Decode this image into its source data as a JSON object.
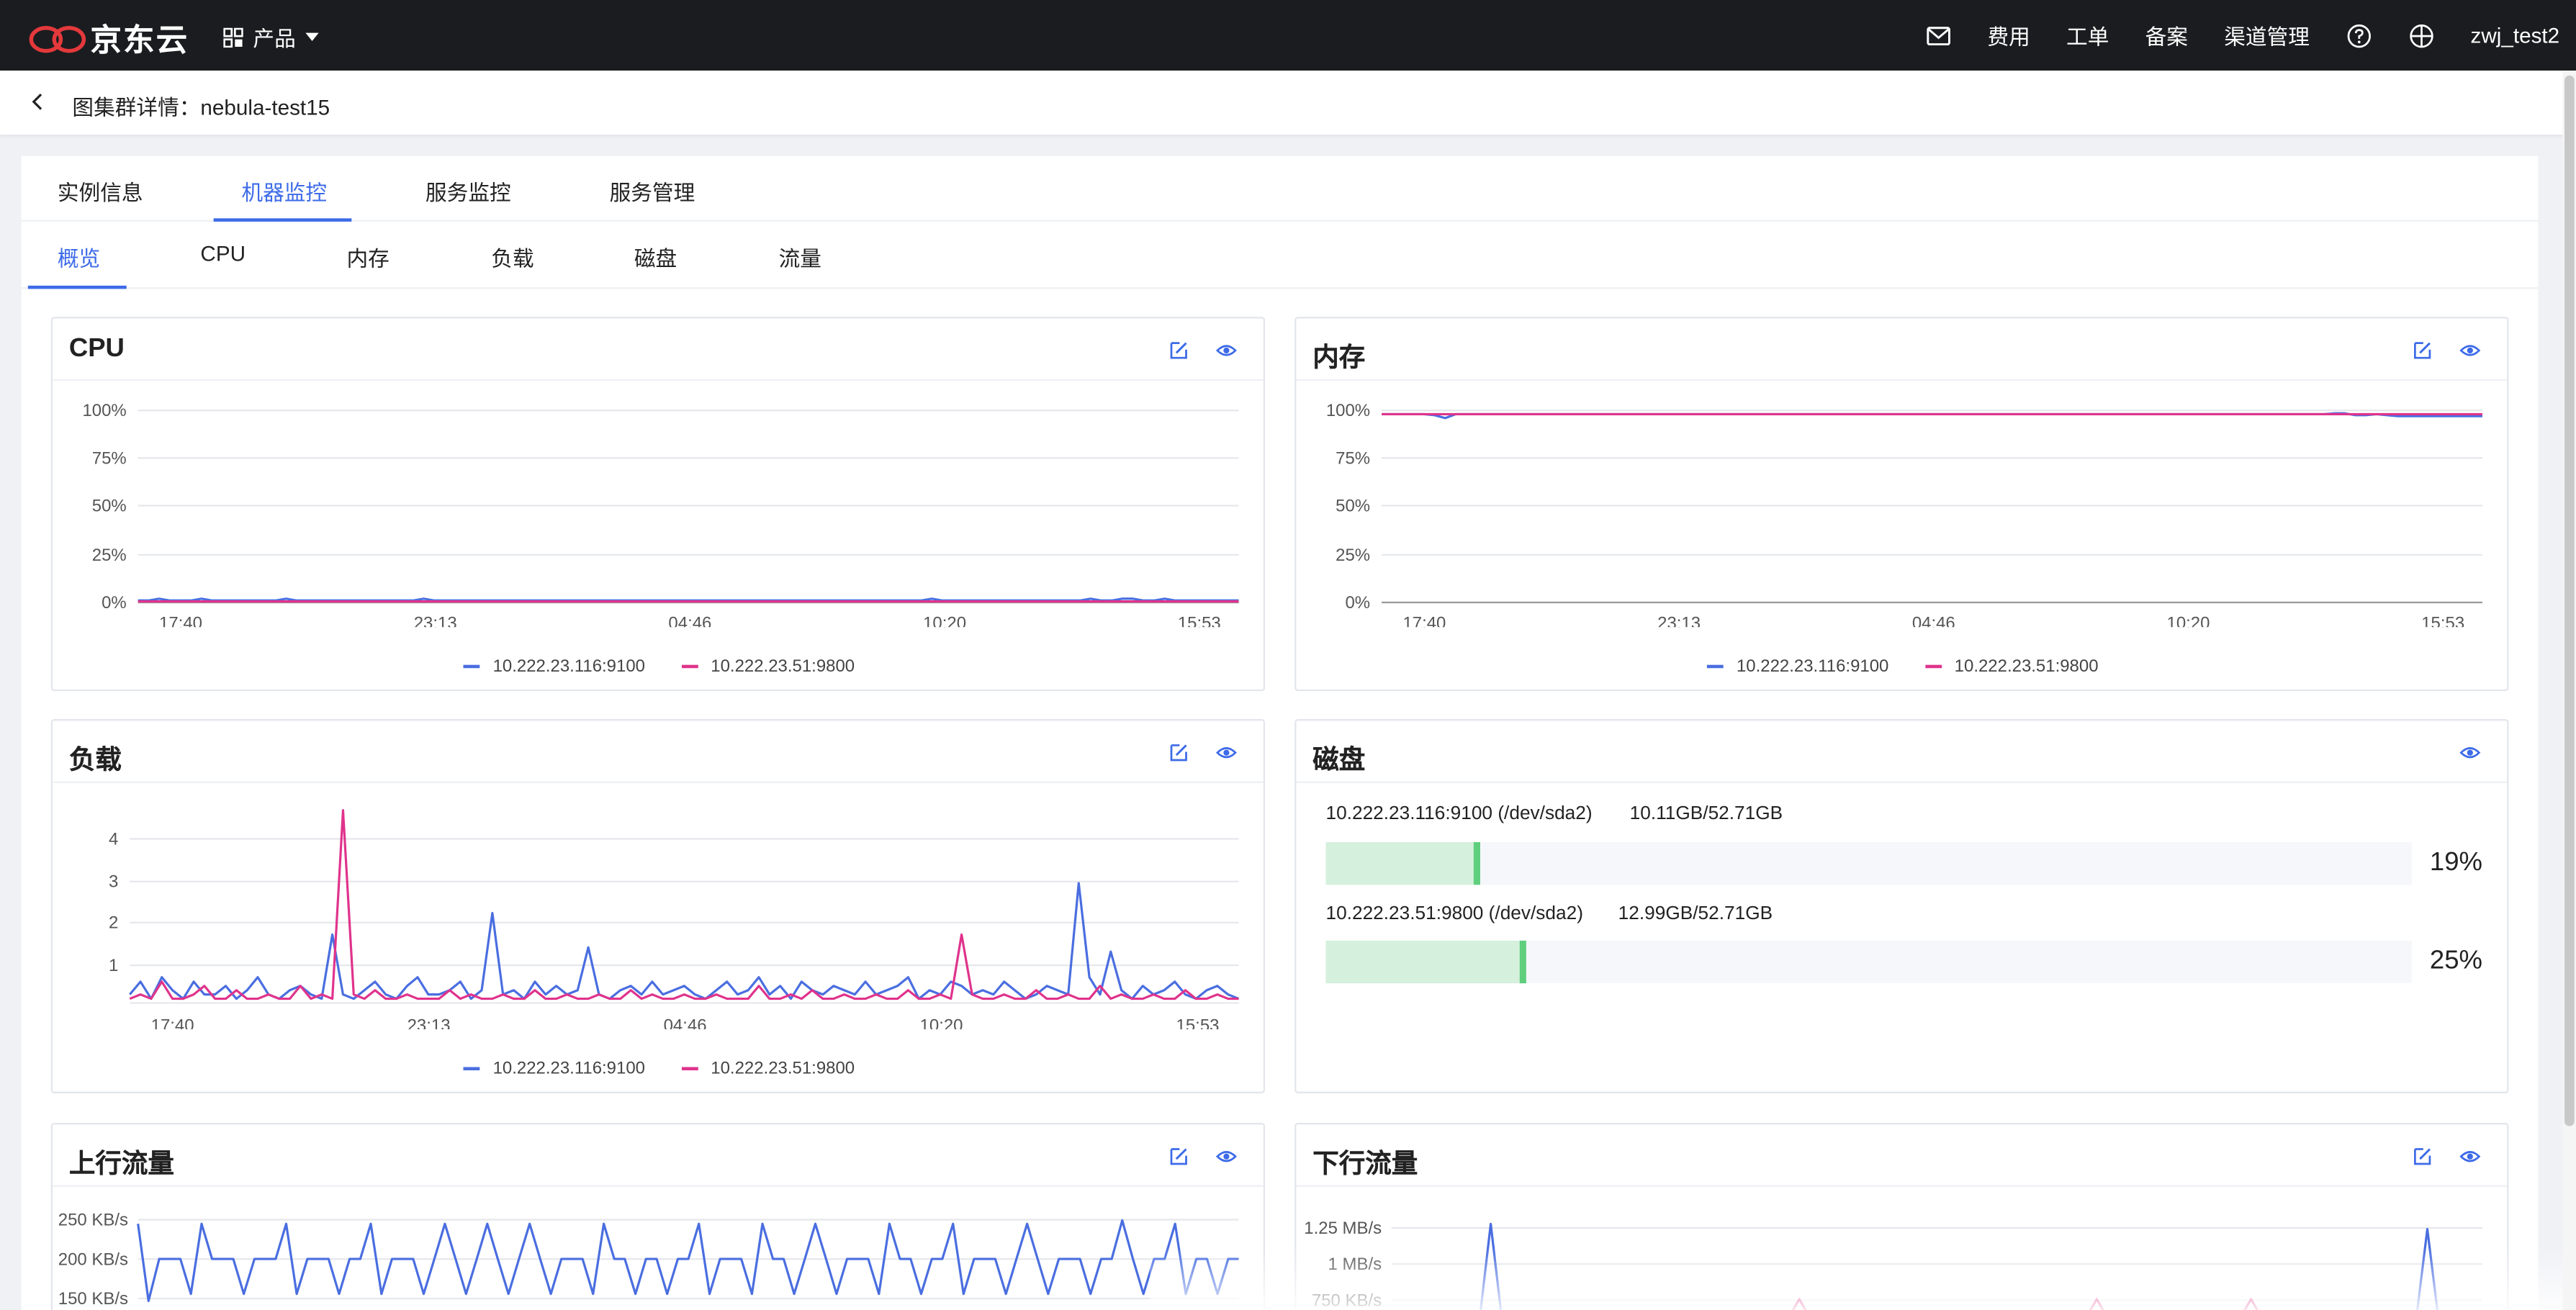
{
  "brand": {
    "name": "京东云",
    "accent": "#e4393c"
  },
  "topnav": {
    "product_label": "产品",
    "items": [
      "费用",
      "工单",
      "备案",
      "渠道管理"
    ],
    "username": "zwj_test2"
  },
  "page": {
    "title": "图集群详情：nebula-test15"
  },
  "tabs": [
    "实例信息",
    "机器监控",
    "服务监控",
    "服务管理"
  ],
  "active_tab": "机器监控",
  "subtabs": [
    "概览",
    "CPU",
    "内存",
    "负载",
    "磁盘",
    "流量"
  ],
  "active_subtab": "概览",
  "colors": {
    "series1": "#4a6ee0",
    "series2": "#e0338c",
    "active": "#3d6be8",
    "disk_fill": "#d5f0dc",
    "disk_tip": "#5fcf7d"
  },
  "panels": {
    "cpu": {
      "title": "CPU"
    },
    "memory": {
      "title": "内存"
    },
    "load": {
      "title": "负载"
    },
    "disk": {
      "title": "磁盘"
    },
    "upstream": {
      "title": "上行流量"
    },
    "downstream": {
      "title": "下行流量"
    }
  },
  "legend": [
    "10.222.23.116:9100",
    "10.222.23.51:9800"
  ],
  "disk": [
    {
      "label": "10.222.23.116:9100 (/dev/sda2)",
      "usage": "10.11GB/52.71GB",
      "pct_label": "19%",
      "pct": 19
    },
    {
      "label": "10.222.23.51:9800 (/dev/sda2)",
      "usage": "12.99GB/52.71GB",
      "pct_label": "25%",
      "pct": 25
    }
  ],
  "chart_data": [
    {
      "id": "cpu",
      "type": "line",
      "x_ticks": [
        "17:40",
        "23:13",
        "04:46",
        "10:20",
        "15:53"
      ],
      "y_ticks": [
        "100%",
        "75%",
        "50%",
        "25%",
        "0%"
      ],
      "ylim": [
        0,
        100
      ],
      "series": [
        {
          "name": "10.222.23.116:9100",
          "values": [
            1,
            1,
            2,
            1,
            1,
            1,
            2,
            1,
            1,
            1,
            1,
            1,
            1,
            1,
            2,
            1,
            1,
            1,
            1,
            1,
            1,
            1,
            1,
            1,
            1,
            1,
            1,
            2,
            1,
            1,
            1,
            1,
            1,
            1,
            1,
            1,
            1,
            1,
            1,
            1,
            1,
            1,
            1,
            1,
            1,
            1,
            1,
            1,
            1,
            1,
            1,
            1,
            1,
            1,
            1,
            1,
            1,
            1,
            1,
            1,
            1,
            1,
            1,
            1,
            1,
            1,
            1,
            1,
            1,
            1,
            1,
            1,
            1,
            1,
            1,
            2,
            1,
            1,
            1,
            1,
            1,
            1,
            1,
            1,
            1,
            1,
            1,
            1,
            1,
            1,
            2,
            1,
            1,
            2,
            2,
            1,
            1,
            2,
            1,
            1,
            1,
            1,
            1,
            1,
            1
          ]
        },
        {
          "name": "10.222.23.51:9800",
          "values": [
            0.5,
            0.5,
            0.5,
            0.5,
            0.5,
            0.5,
            0.5,
            0.5,
            0.5,
            0.5,
            0.5,
            0.5,
            0.5,
            0.5,
            0.5,
            0.5,
            0.5,
            0.5,
            0.5,
            0.5,
            0.5,
            0.5,
            0.5,
            0.5,
            0.5,
            0.5,
            0.5,
            0.5,
            0.5,
            0.5,
            0.5,
            0.5,
            0.5,
            0.5,
            0.5,
            0.5,
            0.5,
            0.5,
            0.5,
            0.5,
            0.5,
            0.5,
            0.5,
            0.5,
            0.5,
            0.5,
            0.5,
            0.5,
            0.5,
            0.5,
            0.5,
            0.5,
            0.5,
            0.5,
            0.5,
            0.5,
            0.5,
            0.5,
            0.5,
            0.5,
            0.5,
            0.5,
            0.5,
            0.5,
            0.5,
            0.5,
            0.5,
            0.5,
            0.5,
            0.5,
            0.5,
            0.5,
            0.5,
            0.5,
            0.5,
            0.5,
            0.5,
            0.5,
            0.5,
            0.5,
            0.5,
            0.5,
            0.5,
            0.5,
            0.5,
            0.5,
            0.5,
            0.5,
            0.5,
            0.5,
            0.5,
            0.5,
            0.5,
            0.5,
            0.5,
            0.5,
            0.5,
            0.5,
            0.5,
            0.5,
            0.5,
            0.5,
            0.5,
            0.5,
            0.5
          ]
        }
      ]
    },
    {
      "id": "memory",
      "type": "line",
      "x_ticks": [
        "17:40",
        "23:13",
        "04:46",
        "10:20",
        "15:53"
      ],
      "y_ticks": [
        "100%",
        "75%",
        "50%",
        "25%",
        "0%"
      ],
      "ylim": [
        0,
        100
      ],
      "series": [
        {
          "name": "10.222.23.116:9100",
          "values": [
            98,
            98,
            98,
            98,
            98,
            97.5,
            96,
            98,
            98,
            98,
            98,
            98,
            98,
            98,
            98,
            98,
            98,
            98,
            98,
            98,
            98,
            98,
            98,
            98,
            98,
            98,
            98,
            98,
            98,
            98,
            98,
            98,
            98,
            98,
            98,
            98,
            98,
            98,
            98,
            98,
            98,
            98,
            98,
            98,
            98,
            98,
            98,
            98,
            98,
            98,
            98,
            98,
            98,
            98,
            98,
            98,
            98,
            98,
            98,
            98,
            98,
            98,
            98,
            98,
            98,
            98,
            98,
            98,
            98,
            98,
            98,
            98,
            98,
            98,
            98,
            98,
            98,
            98,
            98,
            98,
            98,
            98,
            98,
            98,
            98,
            98,
            98,
            98,
            98,
            98,
            98.5,
            98.5,
            97.5,
            97.5,
            98,
            97.5,
            97,
            97,
            97,
            97,
            97,
            97,
            97,
            97,
            97
          ]
        },
        {
          "name": "10.222.23.51:9800",
          "values": [
            98,
            98,
            98,
            98,
            98,
            98,
            98,
            98,
            98,
            98,
            98,
            98,
            98,
            98,
            98,
            98,
            98,
            98,
            98,
            98,
            98,
            98,
            98,
            98,
            98,
            98,
            98,
            98,
            98,
            98,
            98,
            98,
            98,
            98,
            98,
            98,
            98,
            98,
            98,
            98,
            98,
            98,
            98,
            98,
            98,
            98,
            98,
            98,
            98,
            98,
            98,
            98,
            98,
            98,
            98,
            98,
            98,
            98,
            98,
            98,
            98,
            98,
            98,
            98,
            98,
            98,
            98,
            98,
            98,
            98,
            98,
            98,
            98,
            98,
            98,
            98,
            98,
            98,
            98,
            98,
            98,
            98,
            98,
            98,
            98,
            98,
            98,
            98,
            98,
            98,
            98,
            98,
            98,
            98,
            98,
            98,
            98,
            98,
            98,
            98,
            98,
            98,
            98,
            98,
            98
          ]
        }
      ]
    },
    {
      "id": "load",
      "type": "line",
      "x_ticks": [
        "17:40",
        "23:13",
        "04:46",
        "10:20",
        "15:53"
      ],
      "y_ticks": [
        "4",
        "3",
        "2",
        "1"
      ],
      "ylim": [
        0,
        4.6
      ],
      "series": [
        {
          "name": "10.222.23.116:9100",
          "values": [
            0.2,
            0.5,
            0.1,
            0.6,
            0.3,
            0.1,
            0.5,
            0.2,
            0.2,
            0.4,
            0.1,
            0.3,
            0.6,
            0.2,
            0.1,
            0.3,
            0.4,
            0.2,
            0.1,
            1.6,
            0.2,
            0.1,
            0.3,
            0.5,
            0.2,
            0.1,
            0.4,
            0.6,
            0.2,
            0.2,
            0.3,
            0.5,
            0.1,
            0.3,
            2.1,
            0.2,
            0.3,
            0.1,
            0.5,
            0.2,
            0.4,
            0.2,
            0.3,
            1.3,
            0.2,
            0.1,
            0.3,
            0.4,
            0.2,
            0.5,
            0.2,
            0.3,
            0.4,
            0.2,
            0.1,
            0.3,
            0.5,
            0.2,
            0.3,
            0.6,
            0.2,
            0.4,
            0.1,
            0.5,
            0.3,
            0.2,
            0.4,
            0.3,
            0.2,
            0.5,
            0.2,
            0.3,
            0.4,
            0.6,
            0.1,
            0.3,
            0.2,
            0.5,
            0.4,
            0.2,
            0.3,
            0.2,
            0.5,
            0.3,
            0.1,
            0.2,
            0.4,
            0.3,
            0.2,
            2.8,
            0.6,
            0.2,
            1.2,
            0.3,
            0.1,
            0.4,
            0.2,
            0.3,
            0.5,
            0.2,
            0.1,
            0.3,
            0.4,
            0.2,
            0.1
          ]
        },
        {
          "name": "10.222.23.51:9800",
          "values": [
            0.1,
            0.2,
            0.1,
            0.5,
            0.1,
            0.1,
            0.2,
            0.4,
            0.1,
            0.1,
            0.3,
            0.1,
            0.1,
            0.2,
            0.1,
            0.1,
            0.4,
            0.1,
            0.2,
            0.1,
            4.5,
            0.2,
            0.1,
            0.3,
            0.1,
            0.1,
            0.2,
            0.1,
            0.1,
            0.1,
            0.3,
            0.1,
            0.2,
            0.1,
            0.1,
            0.2,
            0.1,
            0.1,
            0.3,
            0.1,
            0.1,
            0.2,
            0.1,
            0.1,
            0.2,
            0.1,
            0.1,
            0.3,
            0.1,
            0.2,
            0.1,
            0.1,
            0.2,
            0.1,
            0.1,
            0.2,
            0.1,
            0.1,
            0.1,
            0.4,
            0.1,
            0.1,
            0.2,
            0.1,
            0.3,
            0.1,
            0.1,
            0.2,
            0.1,
            0.1,
            0.2,
            0.1,
            0.1,
            0.3,
            0.1,
            0.1,
            0.2,
            0.1,
            1.6,
            0.2,
            0.1,
            0.1,
            0.2,
            0.1,
            0.1,
            0.3,
            0.1,
            0.1,
            0.2,
            0.1,
            0.1,
            0.4,
            0.1,
            0.2,
            0.1,
            0.1,
            0.2,
            0.1,
            0.1,
            0.3,
            0.1,
            0.1,
            0.2,
            0.1,
            0.1
          ]
        }
      ]
    },
    {
      "id": "upstream",
      "type": "line",
      "y_ticks": [
        "250 KB/s",
        "200 KB/s",
        "150 KB/s"
      ],
      "ylim": [
        120,
        270
      ],
      "series": [
        {
          "name": "10.222.23.116:9100",
          "values": [
            250,
            140,
            200,
            200,
            200,
            150,
            250,
            200,
            200,
            200,
            150,
            200,
            200,
            200,
            250,
            150,
            200,
            200,
            200,
            150,
            200,
            200,
            250,
            150,
            200,
            200,
            200,
            150,
            200,
            250,
            200,
            150,
            200,
            250,
            200,
            150,
            200,
            250,
            200,
            150,
            200,
            200,
            200,
            150,
            250,
            200,
            200,
            150,
            200,
            200,
            150,
            200,
            200,
            250,
            150,
            200,
            200,
            200,
            150,
            250,
            200,
            200,
            150,
            200,
            250,
            200,
            150,
            200,
            200,
            200,
            150,
            250,
            200,
            200,
            150,
            200,
            200,
            250,
            150,
            200,
            200,
            200,
            150,
            200,
            250,
            200,
            150,
            200,
            200,
            200,
            150,
            200,
            200,
            255,
            200,
            150,
            200,
            200,
            250,
            150,
            200,
            200,
            150,
            200,
            200
          ]
        }
      ]
    },
    {
      "id": "downstream",
      "type": "line",
      "y_ticks": [
        "1.25 MB/s",
        "1 MB/s",
        "750 KB/s"
      ],
      "ylim": [
        0.6,
        1.4
      ],
      "series": [
        {
          "name": "10.222.23.116:9100",
          "values": [
            0.6,
            0.6,
            0.6,
            0.6,
            0.6,
            0.6,
            0.6,
            0.6,
            0.6,
            1.34,
            0.6,
            0.6,
            0.6,
            0.6,
            0.6,
            0.6,
            0.6,
            0.6,
            0.6,
            0.6,
            0.6,
            0.6,
            0.6,
            0.6,
            0.6,
            0.6,
            0.6,
            0.6,
            0.6,
            0.6,
            0.6,
            0.6,
            0.6,
            0.6,
            0.6,
            0.6,
            0.6,
            0.6,
            0.6,
            0.6,
            0.6,
            0.6,
            0.6,
            0.6,
            0.6,
            0.6,
            0.6,
            0.6,
            0.6,
            0.6,
            0.6,
            0.6,
            0.6,
            0.6,
            0.6,
            0.6,
            0.6,
            0.6,
            0.6,
            0.6,
            0.6,
            0.6,
            0.6,
            0.6,
            0.6,
            0.6,
            0.6,
            0.6,
            0.6,
            0.6,
            0.6,
            0.6,
            0.6,
            0.6,
            0.6,
            0.6,
            0.6,
            0.6,
            0.6,
            0.6,
            0.6,
            0.6,
            0.6,
            0.6,
            0.6,
            0.6,
            0.6,
            0.6,
            0.6,
            0.6,
            0.6,
            0.6,
            0.6,
            0.6,
            1.3,
            0.6,
            0.6,
            0.6,
            0.6,
            0.6
          ]
        },
        {
          "name": "10.222.23.51:9800",
          "values": [
            0.6,
            0.6,
            0.6,
            0.6,
            0.6,
            0.6,
            0.6,
            0.6,
            0.6,
            0.6,
            0.6,
            0.6,
            0.6,
            0.6,
            0.6,
            0.6,
            0.6,
            0.6,
            0.6,
            0.6,
            0.6,
            0.6,
            0.6,
            0.6,
            0.6,
            0.6,
            0.6,
            0.6,
            0.6,
            0.6,
            0.6,
            0.6,
            0.6,
            0.6,
            0.6,
            0.6,
            0.6,
            0.75,
            0.6,
            0.6,
            0.6,
            0.6,
            0.6,
            0.6,
            0.6,
            0.6,
            0.6,
            0.6,
            0.6,
            0.6,
            0.6,
            0.6,
            0.6,
            0.6,
            0.6,
            0.6,
            0.6,
            0.6,
            0.6,
            0.6,
            0.6,
            0.6,
            0.6,
            0.6,
            0.75,
            0.6,
            0.6,
            0.6,
            0.6,
            0.6,
            0.6,
            0.6,
            0.6,
            0.6,
            0.6,
            0.6,
            0.6,
            0.6,
            0.75,
            0.6,
            0.6,
            0.6,
            0.6,
            0.6,
            0.6,
            0.6,
            0.6,
            0.6,
            0.6,
            0.6,
            0.6,
            0.6,
            0.6,
            0.6,
            0.6,
            0.6,
            0.6,
            0.6,
            0.6,
            0.6
          ]
        }
      ]
    }
  ]
}
